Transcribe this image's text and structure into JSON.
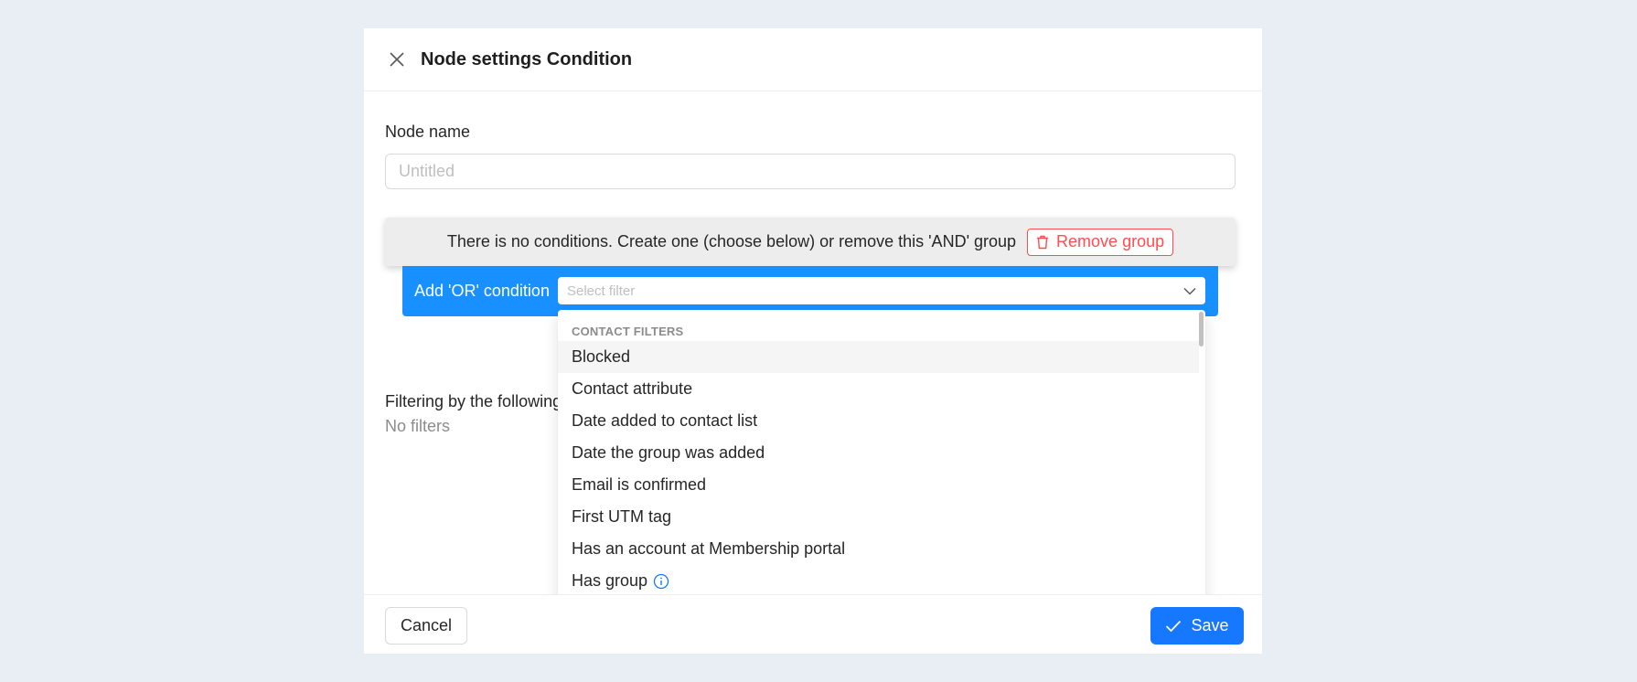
{
  "modal": {
    "title": "Node settings Condition"
  },
  "node_name": {
    "label": "Node name",
    "value": "",
    "placeholder": "Untitled"
  },
  "and_group": {
    "message": "There is no conditions. Create one (choose below) or remove this 'AND' group",
    "remove_label": "Remove group"
  },
  "or_condition": {
    "label": "Add 'OR' condition",
    "select_placeholder": "Select filter"
  },
  "filtering": {
    "label": "Filtering by the following",
    "empty_text": "No filters"
  },
  "dropdown": {
    "group_title": "CONTACT FILTERS",
    "items": [
      {
        "label": "Blocked"
      },
      {
        "label": "Contact attribute"
      },
      {
        "label": "Date added to contact list"
      },
      {
        "label": "Date the group was added"
      },
      {
        "label": "Email is confirmed"
      },
      {
        "label": "First UTM tag"
      },
      {
        "label": "Has an account at Membership portal"
      },
      {
        "label": "Has group"
      }
    ]
  },
  "footer": {
    "cancel_label": "Cancel",
    "save_label": "Save"
  },
  "colors": {
    "primary": "#1677ff",
    "or_bar": "#1890ff",
    "danger": "#ff4d4f",
    "background": "#e9edf4"
  },
  "icons": {
    "close": "close-icon",
    "trash": "trash-icon",
    "chevron": "chevron-down-icon",
    "info": "info-icon",
    "check": "check-icon"
  }
}
